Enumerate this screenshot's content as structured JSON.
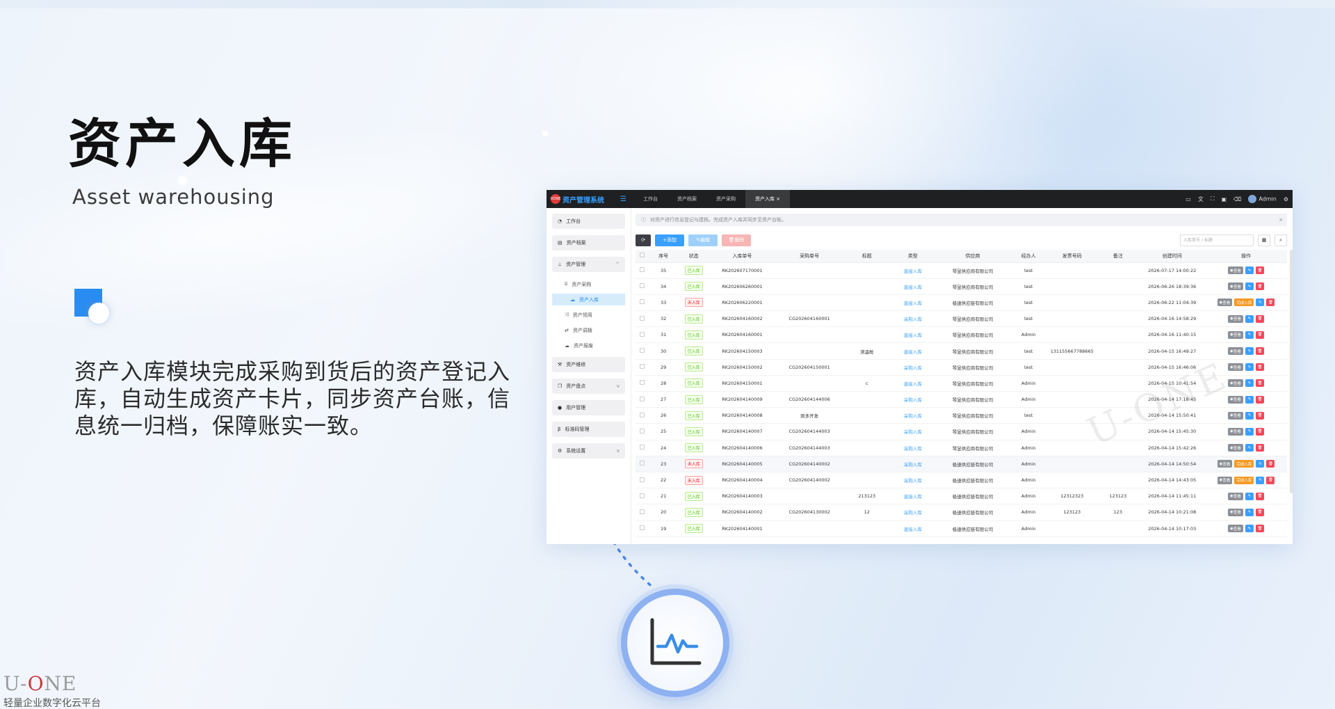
{
  "hero": {
    "title": "资产入库",
    "subtitle": "Asset warehousing",
    "description": "资产入库模块完成采购到货后的资产登记入库，自动生成资产卡片，同步资产台账，信息统一归档，保障账实一致。"
  },
  "footer_logo": {
    "brand_prefix": "U-",
    "brand_o": "O",
    "brand_suffix": "NE",
    "tagline": "轻量企业数字化云平台"
  },
  "app": {
    "badge": "UONE",
    "name": "资产管理系统",
    "tabs": [
      "工作台",
      "资产档案",
      "资产采购",
      "资产入库"
    ],
    "active_tab": "资产入库",
    "user": "Admin",
    "sidebar": {
      "items": [
        {
          "label": "工作台",
          "icon": "dashboard-icon"
        },
        {
          "label": "资产档案",
          "icon": "archive-icon"
        },
        {
          "label": "资产管理",
          "icon": "tree-icon",
          "expanded": true
        }
      ],
      "subitems": [
        {
          "label": "资产采购",
          "icon": "cart-icon",
          "active": false
        },
        {
          "label": "资产入库",
          "icon": "cloud-icon",
          "active": true
        },
        {
          "label": "资产领用",
          "icon": "shuffle-icon",
          "active": false
        },
        {
          "label": "资产调拨",
          "icon": "transfer-icon",
          "active": false
        },
        {
          "label": "资产报废",
          "icon": "cloud-icon",
          "active": false
        }
      ],
      "items2": [
        {
          "label": "资产维修",
          "icon": "wrench-icon"
        },
        {
          "label": "资产盘点",
          "icon": "copy-icon",
          "has_chevron": true
        },
        {
          "label": "用户管理",
          "icon": "user-icon"
        },
        {
          "label": "标准码管理",
          "icon": "code-icon"
        },
        {
          "label": "系统设置",
          "icon": "gears-icon",
          "has_chevron": true
        }
      ]
    },
    "notice": "对资产进行信息登记与建档，完成资产入库并同步至资产台账。",
    "toolbar": {
      "add": "添加",
      "edit": "编辑",
      "delete": "删除",
      "search_placeholder": "入库单号 / 标题"
    },
    "columns": [
      "序号",
      "状态",
      "入库单号",
      "采购单号",
      "标题",
      "类型",
      "供应商",
      "经办人",
      "发票号码",
      "备注",
      "创建时间",
      "操作"
    ],
    "op_labels": {
      "view": "查看",
      "complete": "完成入库"
    },
    "rows": [
      {
        "no": "35",
        "status": "已入库",
        "ok": true,
        "rk": "RK202607170001",
        "cg": "",
        "title": "",
        "type": "直接入库",
        "supplier": "琴昱供应商有限公司",
        "handler": "test",
        "invoice": "",
        "remark": "",
        "time": "2026-07-17 14:00:22"
      },
      {
        "no": "34",
        "status": "已入库",
        "ok": true,
        "rk": "RK202606260001",
        "cg": "",
        "title": "",
        "type": "直接入库",
        "supplier": "琴昱供应商有限公司",
        "handler": "test",
        "invoice": "",
        "remark": "",
        "time": "2026-06-26 18:39:36"
      },
      {
        "no": "33",
        "status": "未入库",
        "ok": false,
        "rk": "RK202606220001",
        "cg": "",
        "title": "",
        "type": "直接入库",
        "supplier": "极速供应链有限公司",
        "handler": "test",
        "invoice": "",
        "remark": "",
        "time": "2026-06-22 11:04:39"
      },
      {
        "no": "32",
        "status": "已入库",
        "ok": true,
        "rk": "RK202604160002",
        "cg": "CG202604160001",
        "title": "",
        "type": "采购入库",
        "supplier": "琴昱供应商有限公司",
        "handler": "test",
        "invoice": "",
        "remark": "",
        "time": "2026-04-16 14:58:29"
      },
      {
        "no": "31",
        "status": "已入库",
        "ok": true,
        "rk": "RK202604160001",
        "cg": "",
        "title": "",
        "type": "直接入库",
        "supplier": "琴昱供应商有限公司",
        "handler": "Admin",
        "invoice": "",
        "remark": "",
        "time": "2026-04-16 11:40:15"
      },
      {
        "no": "30",
        "status": "已入库",
        "ok": true,
        "rk": "RK202604150003",
        "cg": "",
        "title": "测温枪",
        "type": "直接入库",
        "supplier": "琴昱供应商有限公司",
        "handler": "test",
        "invoice": "131155667788665",
        "remark": "",
        "time": "2026-04-15 16:49:27"
      },
      {
        "no": "29",
        "status": "已入库",
        "ok": true,
        "rk": "RK202604150002",
        "cg": "CG202604150001",
        "title": "",
        "type": "采购入库",
        "supplier": "琴昱供应商有限公司",
        "handler": "test",
        "invoice": "",
        "remark": "",
        "time": "2026-04-15 16:46:06"
      },
      {
        "no": "28",
        "status": "已入库",
        "ok": true,
        "rk": "RK202604150001",
        "cg": "",
        "title": "c",
        "type": "直接入库",
        "supplier": "琴昱供应商有限公司",
        "handler": "Admin",
        "invoice": "",
        "remark": "",
        "time": "2026-04-15 10:41:54"
      },
      {
        "no": "27",
        "status": "已入库",
        "ok": true,
        "rk": "RK202604140009",
        "cg": "CG202604144006",
        "title": "",
        "type": "采购入库",
        "supplier": "琴昱供应商有限公司",
        "handler": "Admin",
        "invoice": "",
        "remark": "",
        "time": "2026-04-14 17:18:45"
      },
      {
        "no": "26",
        "status": "已入库",
        "ok": true,
        "rk": "RK202604140008",
        "cg": "则多开发",
        "title": "",
        "type": "采购入库",
        "supplier": "琴昱供应商有限公司",
        "handler": "test",
        "invoice": "",
        "remark": "",
        "time": "2026-04-14 15:50:41"
      },
      {
        "no": "25",
        "status": "已入库",
        "ok": true,
        "rk": "RK202604140007",
        "cg": "CG202604144003",
        "title": "",
        "type": "采购入库",
        "supplier": "琴昱供应商有限公司",
        "handler": "Admin",
        "invoice": "",
        "remark": "",
        "time": "2026-04-14 15:45:30"
      },
      {
        "no": "24",
        "status": "已入库",
        "ok": true,
        "rk": "RK202604140006",
        "cg": "CG202604144003",
        "title": "",
        "type": "采购入库",
        "supplier": "琴昱供应商有限公司",
        "handler": "Admin",
        "invoice": "",
        "remark": "",
        "time": "2026-04-14 15:42:26"
      },
      {
        "no": "23",
        "status": "未入库",
        "ok": false,
        "rk": "RK202604140005",
        "cg": "CG202604140002",
        "title": "",
        "type": "采购入库",
        "supplier": "极速供应链有限公司",
        "handler": "Admin",
        "invoice": "",
        "remark": "",
        "time": "2026-04-14 14:50:54"
      },
      {
        "no": "22",
        "status": "未入库",
        "ok": false,
        "rk": "RK202604140004",
        "cg": "CG202604140002",
        "title": "",
        "type": "采购入库",
        "supplier": "极速供应链有限公司",
        "handler": "Admin",
        "invoice": "",
        "remark": "",
        "time": "2026-04-14 14:43:05"
      },
      {
        "no": "21",
        "status": "已入库",
        "ok": true,
        "rk": "RK202604140003",
        "cg": "",
        "title": "213123",
        "type": "直接入库",
        "supplier": "极速供应链有限公司",
        "handler": "Admin",
        "invoice": "12312323",
        "remark": "123123",
        "time": "2026-04-14 11:45:11"
      },
      {
        "no": "20",
        "status": "已入库",
        "ok": true,
        "rk": "RK202604140002",
        "cg": "CG202604130002",
        "title": "12",
        "type": "采购入库",
        "supplier": "极速供应链有限公司",
        "handler": "Admin",
        "invoice": "123123",
        "remark": "123",
        "time": "2026-04-14 10:21:08"
      },
      {
        "no": "19",
        "status": "已入库",
        "ok": true,
        "rk": "RK202604140001",
        "cg": "",
        "title": "",
        "type": "直接入库",
        "supplier": "极速供应链有限公司",
        "handler": "Admin",
        "invoice": "",
        "remark": "",
        "time": "2026-04-14 10:17:03"
      }
    ],
    "watermark": "U-ONE"
  }
}
